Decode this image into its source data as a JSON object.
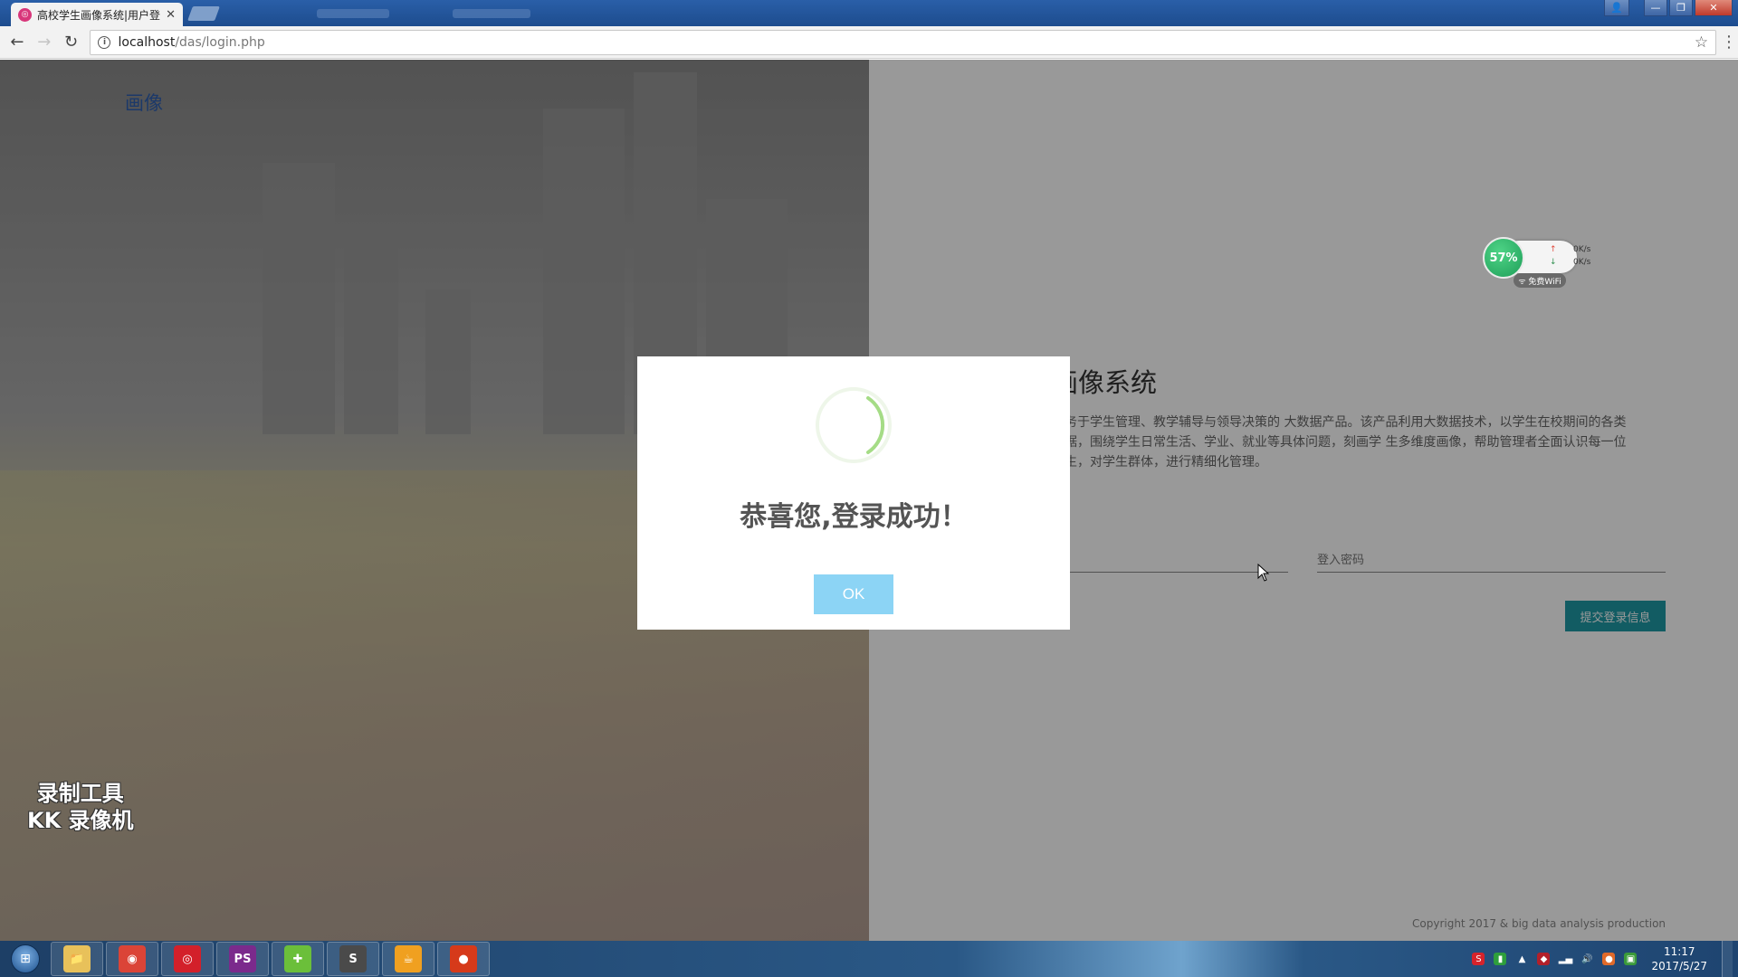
{
  "browser": {
    "tab_title": "高校学生画像系统|用户登录",
    "tab_favicon_icon": "das-logo-icon",
    "url_host": "localhost",
    "url_path": "/das/login.php"
  },
  "page": {
    "brand_text": "画像",
    "system_title": "画像系统",
    "description": "服务于学生管理、教学辅导与领导决策的 大数据产品。该产品利用大数据技术，以学生在校期间的各类数据，围绕学生日常生活、学业、就业等具体问题，刻画学 生多维度画像，帮助管理者全面认识每一位学生，对学生群体，进行精细化管理。",
    "password_placeholder": "登入密码",
    "submit_label": "提交登录信息",
    "copyright": "Copyright 2017 & big data analysis production",
    "watermark_line1": "录制工具",
    "watermark_line2": "KK 录像机"
  },
  "net_widget": {
    "percent": "57%",
    "upload": "0K/s",
    "download": "0K/s",
    "wifi_label": "免费WiFi"
  },
  "modal": {
    "title": "恭喜您,登录成功！",
    "ok_label": "OK",
    "accent_color": "#8cd4f5",
    "success_color": "#a5dc86"
  },
  "taskbar": {
    "items": [
      {
        "name": "file-explorer-icon",
        "glyph": "📁",
        "color": "#e8c15a"
      },
      {
        "name": "chrome-icon",
        "glyph": "◉",
        "color": "#db4437"
      },
      {
        "name": "netease-music-icon",
        "glyph": "◎",
        "color": "#d3202a"
      },
      {
        "name": "phpstorm-icon",
        "glyph": "PS",
        "color": "#7b2a8c"
      },
      {
        "name": "green-app-icon",
        "glyph": "✚",
        "color": "#6bbf3a"
      },
      {
        "name": "sublime-text-icon",
        "glyph": "S",
        "color": "#4a4a4a"
      },
      {
        "name": "java-icon",
        "glyph": "☕",
        "color": "#f0a020"
      },
      {
        "name": "recorder-icon",
        "glyph": "●",
        "color": "#d63a1a"
      }
    ],
    "time": "11:17",
    "date": "2017/5/27"
  }
}
